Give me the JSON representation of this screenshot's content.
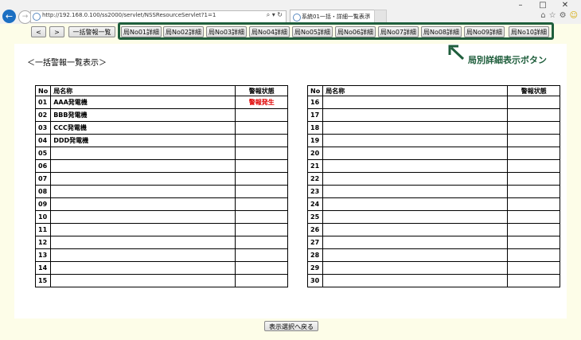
{
  "browser": {
    "url": "http://192.168.0.100/ss2000/servlet/NSSResourceServlet?1=1",
    "search_icon": "⌕",
    "dropdown_icon": "▾",
    "refresh_icon": "↻",
    "tab_title": "系統01一括・詳細一覧表示",
    "tab_close": "×",
    "window_min": "–",
    "window_max": "□",
    "window_close": "✕"
  },
  "toolbar": {
    "prev_label": "<",
    "next_label": ">",
    "overview_label": "一括警報一覧",
    "station_buttons": [
      "局No01詳細",
      "局No02詳細",
      "局No03詳細",
      "局No04詳細",
      "局No05詳細",
      "局No06詳細",
      "局No07詳細",
      "局No08詳細",
      "局No09詳細",
      "局No10詳細"
    ]
  },
  "callout": {
    "label": "局別詳細表示ボタン",
    "color": "#1f5e3c"
  },
  "page": {
    "heading": "＜一括警報一覧表示＞",
    "back_button": "表示選択へ戻る"
  },
  "table": {
    "headers": {
      "no": "No",
      "name": "局名称",
      "status": "警報状態"
    },
    "alarm_color": "#e00000",
    "left_rows": [
      {
        "no": "01",
        "name": "AAA発電機",
        "status": "警報発生"
      },
      {
        "no": "02",
        "name": "BBB発電機",
        "status": ""
      },
      {
        "no": "03",
        "name": "CCC発電機",
        "status": ""
      },
      {
        "no": "04",
        "name": "DDD発電機",
        "status": ""
      },
      {
        "no": "05",
        "name": "",
        "status": ""
      },
      {
        "no": "06",
        "name": "",
        "status": ""
      },
      {
        "no": "07",
        "name": "",
        "status": ""
      },
      {
        "no": "08",
        "name": "",
        "status": ""
      },
      {
        "no": "09",
        "name": "",
        "status": ""
      },
      {
        "no": "10",
        "name": "",
        "status": ""
      },
      {
        "no": "11",
        "name": "",
        "status": ""
      },
      {
        "no": "12",
        "name": "",
        "status": ""
      },
      {
        "no": "13",
        "name": "",
        "status": ""
      },
      {
        "no": "14",
        "name": "",
        "status": ""
      },
      {
        "no": "15",
        "name": "",
        "status": ""
      }
    ],
    "right_rows": [
      {
        "no": "16",
        "name": "",
        "status": ""
      },
      {
        "no": "17",
        "name": "",
        "status": ""
      },
      {
        "no": "18",
        "name": "",
        "status": ""
      },
      {
        "no": "19",
        "name": "",
        "status": ""
      },
      {
        "no": "20",
        "name": "",
        "status": ""
      },
      {
        "no": "21",
        "name": "",
        "status": ""
      },
      {
        "no": "22",
        "name": "",
        "status": ""
      },
      {
        "no": "23",
        "name": "",
        "status": ""
      },
      {
        "no": "24",
        "name": "",
        "status": ""
      },
      {
        "no": "25",
        "name": "",
        "status": ""
      },
      {
        "no": "26",
        "name": "",
        "status": ""
      },
      {
        "no": "27",
        "name": "",
        "status": ""
      },
      {
        "no": "28",
        "name": "",
        "status": ""
      },
      {
        "no": "29",
        "name": "",
        "status": ""
      },
      {
        "no": "30",
        "name": "",
        "status": ""
      }
    ]
  }
}
